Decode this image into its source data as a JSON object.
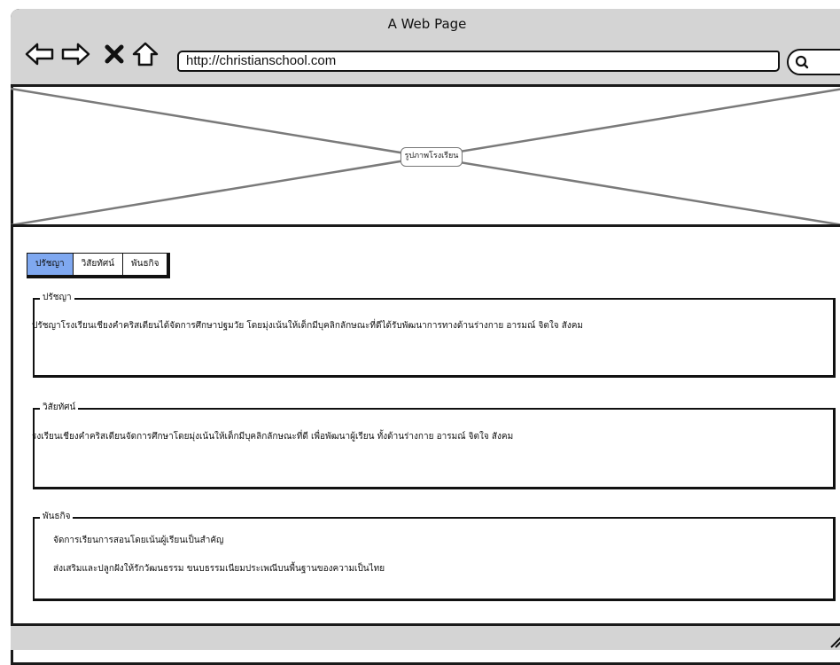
{
  "window": {
    "title": "A Web Page"
  },
  "toolbar": {
    "url": "http://christianschool.com",
    "back_icon": "arrow-left-icon",
    "forward_icon": "arrow-right-icon",
    "stop_icon": "x-icon",
    "home_icon": "home-icon",
    "search_icon": "search-icon"
  },
  "hero": {
    "label": "รูปภาพโรงเรียน"
  },
  "tabs": [
    {
      "label": "ปรัชญา",
      "active": true
    },
    {
      "label": "วิสัยทัศน์",
      "active": false
    },
    {
      "label": "พันธกิจ",
      "active": false
    }
  ],
  "sections": {
    "philosophy": {
      "legend": "ปรัชญา",
      "text": "ปรัชญาโรงเรียนเชียงคำคริสเตียนได้จัดการศึกษาปฐมวัย โดยมุ่งเน้นให้เด็กมีบุคลิกลักษณะที่ดีได้รับพัฒนาการทางด้านร่างกาย อารมณ์ จิตใจ สังคม"
    },
    "vision": {
      "legend": "วิสัยทัศน์",
      "text": "รงเรียนเชียงคำคริสเตียนจัดการศึกษาโดยมุ่งเน้นให้เด็กมีบุคลิกลักษณะที่ดี เพื่อพัฒนาผู้เรียน ทั้งด้านร่างกาย อารมณ์ จิตใจ สังคม"
    },
    "mission": {
      "legend": "พันธกิจ",
      "items": [
        "จัดการเรียนการสอนโดยเน้นผู้เรียนเป็นสำคัญ",
        "ส่งเสริมและปลูกฝังให้รักวัฒนธรรม ขนบธรรมเนียมประเพณีบนพื้นฐานของความเป็นไทย"
      ]
    }
  },
  "colors": {
    "chrome": "#d4d4d4",
    "active_tab": "#7fa8f0",
    "line": "#1a1a1a"
  }
}
